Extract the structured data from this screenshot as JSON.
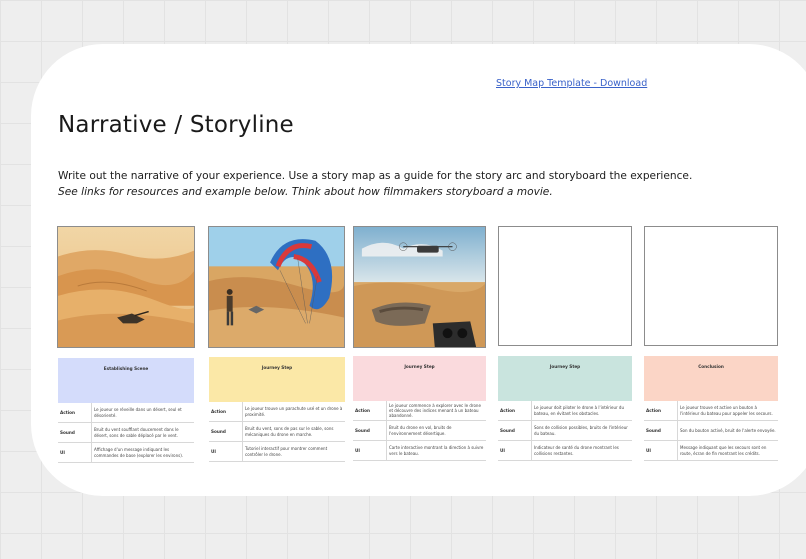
{
  "header": {
    "link_text": "Story Map Template - Download",
    "title": "Narrative / Storyline",
    "description_line1": "Write out the narrative of your experience. Use a story map as a guide for the story arc and storyboard the experience.",
    "description_line2": "See links for resources and example below. Think about how filmmakers storyboard a movie."
  },
  "frames": [
    {
      "image": "desert-dunes-with-crashed-drone"
    },
    {
      "image": "paraglider-in-desert"
    },
    {
      "image": "drone-over-desert-wreck-with-vr-headset"
    },
    {
      "image": "empty"
    },
    {
      "image": "empty"
    }
  ],
  "cards": [
    {
      "title": "Establishing Scene",
      "color": "#d4dcfb",
      "rows": [
        {
          "key": "Action",
          "value": "Le joueur se réveille dans un désert, seul et désorienté."
        },
        {
          "key": "Sound",
          "value": "Bruit du vent soufflant doucement dans le désert, sons de sable déplacé par le vent."
        },
        {
          "key": "UI",
          "value": "Affichage d'un message indiquant les commandes de base (explorer les environs)."
        }
      ]
    },
    {
      "title": "Journey Step",
      "color": "#fbe8a7",
      "rows": [
        {
          "key": "Action",
          "value": "Le joueur trouve un parachute usé et un drone à proximité."
        },
        {
          "key": "Sound",
          "value": "Bruit du vent, sons de pas sur le sable, sons mécaniques du drone en marche."
        },
        {
          "key": "UI",
          "value": "Tutoriel interactif pour montrer comment contrôler le drone."
        }
      ]
    },
    {
      "title": "Journey Step",
      "color": "#fadadd",
      "rows": [
        {
          "key": "Action",
          "value": "Le joueur commence à explorer avec le drone et découvre des indices menant à un bateau abandonné."
        },
        {
          "key": "Sound",
          "value": "Bruit du drone en vol, bruits de l'environnement désertique."
        },
        {
          "key": "UI",
          "value": "Carte interactive montrant la direction à suivre vers le bateau."
        }
      ]
    },
    {
      "title": "Journey Step",
      "color": "#c9e4de",
      "rows": [
        {
          "key": "Action",
          "value": "Le joueur doit piloter le drone à l'intérieur du bateau, en évitant les obstacles."
        },
        {
          "key": "Sound",
          "value": "Sons de collision possibles, bruits de l'intérieur du bateau."
        },
        {
          "key": "UI",
          "value": "Indicateur de santé du drone montrant les collisions restantes."
        }
      ]
    },
    {
      "title": "Conclusion",
      "color": "#fbd5c6",
      "rows": [
        {
          "key": "Action",
          "value": "Le joueur trouve et active un bouton à l'intérieur du bateau pour appeler les secours."
        },
        {
          "key": "Sound",
          "value": "Son du bouton activé, bruit de l'alerte envoyée."
        },
        {
          "key": "UI",
          "value": "Message indiquant que les secours sont en route, écran de fin montrant les crédits."
        }
      ]
    }
  ]
}
